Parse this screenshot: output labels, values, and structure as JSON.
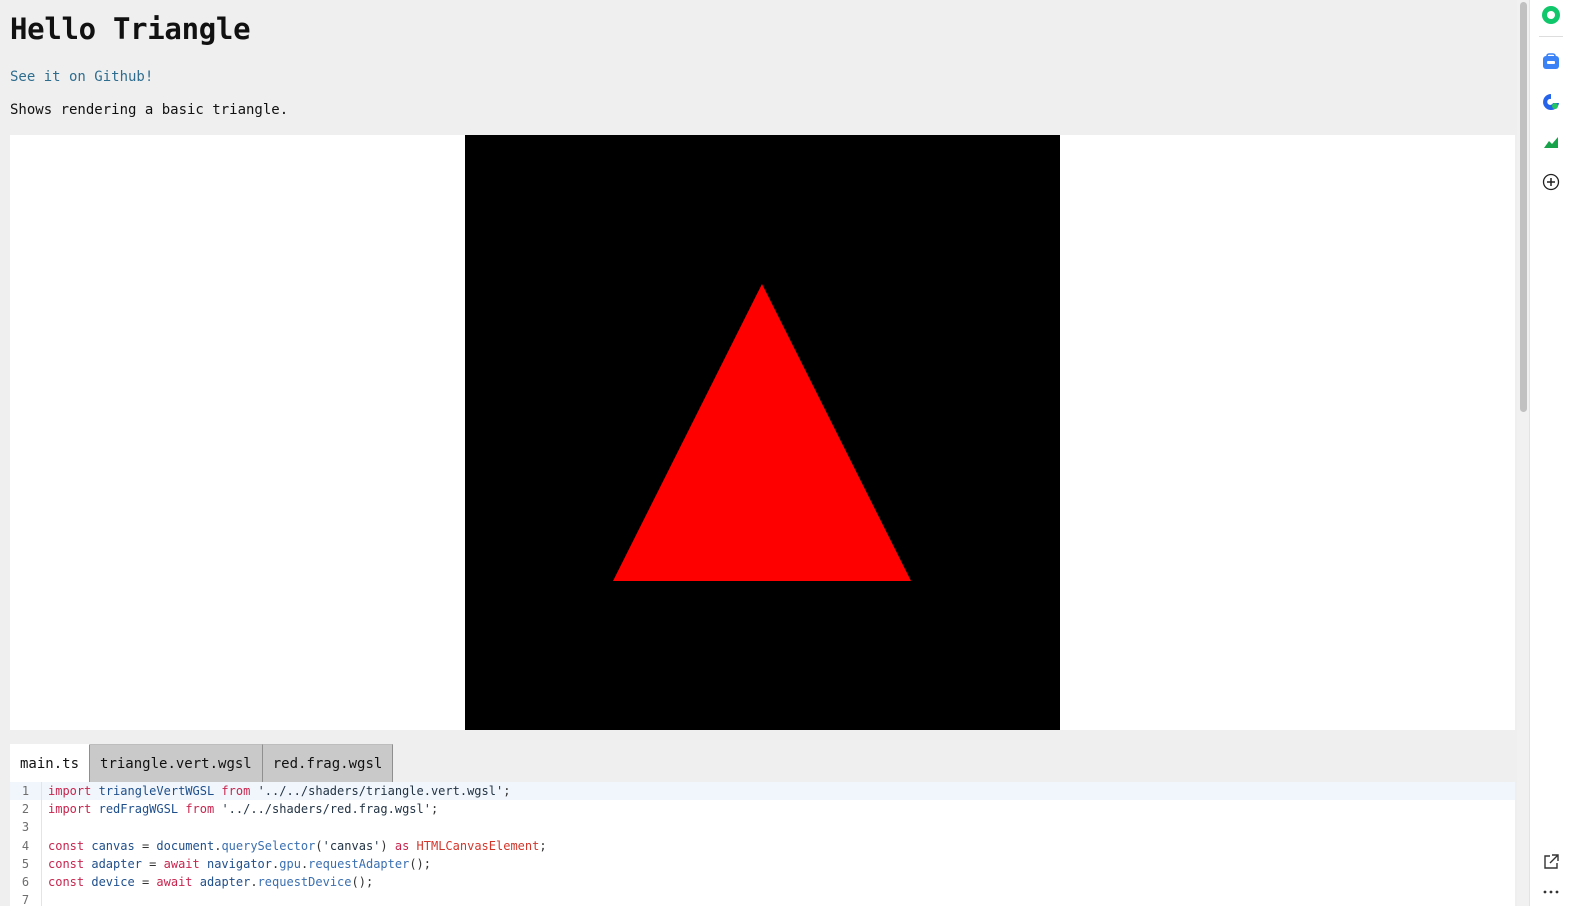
{
  "page": {
    "title": "Hello Triangle",
    "github_link": "See it on Github!",
    "description": "Shows rendering a basic triangle."
  },
  "canvas": {
    "background": "#000000",
    "triangle_color": "#ff0000"
  },
  "tabs": [
    {
      "label": "main.ts",
      "active": true
    },
    {
      "label": "triangle.vert.wgsl",
      "active": false
    },
    {
      "label": "red.frag.wgsl",
      "active": false
    }
  ],
  "editor": {
    "lines": [
      {
        "num": "1",
        "tokens": [
          [
            "kw",
            "import"
          ],
          [
            "pl",
            " "
          ],
          [
            "id",
            "triangleVertWGSL"
          ],
          [
            "pl",
            " "
          ],
          [
            "kw",
            "from"
          ],
          [
            "pl",
            " "
          ],
          [
            "str",
            "'../../shaders/triangle.vert.wgsl'"
          ],
          [
            "pl",
            ";"
          ]
        ]
      },
      {
        "num": "2",
        "tokens": [
          [
            "kw",
            "import"
          ],
          [
            "pl",
            " "
          ],
          [
            "id",
            "redFragWGSL"
          ],
          [
            "pl",
            " "
          ],
          [
            "kw",
            "from"
          ],
          [
            "pl",
            " "
          ],
          [
            "str",
            "'../../shaders/red.frag.wgsl'"
          ],
          [
            "pl",
            ";"
          ]
        ]
      },
      {
        "num": "3",
        "tokens": []
      },
      {
        "num": "4",
        "tokens": [
          [
            "kw",
            "const"
          ],
          [
            "pl",
            " "
          ],
          [
            "id",
            "canvas"
          ],
          [
            "pl",
            " = "
          ],
          [
            "id",
            "document"
          ],
          [
            "pl",
            "."
          ],
          [
            "fn",
            "querySelector"
          ],
          [
            "pl",
            "("
          ],
          [
            "str",
            "'canvas'"
          ],
          [
            "pl",
            ") "
          ],
          [
            "kw",
            "as"
          ],
          [
            "pl",
            " "
          ],
          [
            "ty",
            "HTMLCanvasElement"
          ],
          [
            "pl",
            ";"
          ]
        ]
      },
      {
        "num": "5",
        "tokens": [
          [
            "kw",
            "const"
          ],
          [
            "pl",
            " "
          ],
          [
            "id",
            "adapter"
          ],
          [
            "pl",
            " = "
          ],
          [
            "kw",
            "await"
          ],
          [
            "pl",
            " "
          ],
          [
            "id",
            "navigator"
          ],
          [
            "pl",
            "."
          ],
          [
            "fn",
            "gpu"
          ],
          [
            "pl",
            "."
          ],
          [
            "fn",
            "requestAdapter"
          ],
          [
            "pl",
            "();"
          ]
        ]
      },
      {
        "num": "6",
        "tokens": [
          [
            "kw",
            "const"
          ],
          [
            "pl",
            " "
          ],
          [
            "id",
            "device"
          ],
          [
            "pl",
            " = "
          ],
          [
            "kw",
            "await"
          ],
          [
            "pl",
            " "
          ],
          [
            "id",
            "adapter"
          ],
          [
            "pl",
            "."
          ],
          [
            "fn",
            "requestDevice"
          ],
          [
            "pl",
            "();"
          ]
        ]
      },
      {
        "num": "7",
        "tokens": []
      }
    ]
  },
  "sidebar": {
    "icons": [
      "copilot-icon",
      "shopping-icon",
      "edge-drop-icon",
      "chart-icon",
      "add-icon",
      "open-external-icon",
      "more-icon"
    ],
    "colors": {
      "copilot": "#10c76b",
      "shopping": "#3b82f6",
      "drop": "#2563eb",
      "chart": "#16a34a"
    }
  }
}
